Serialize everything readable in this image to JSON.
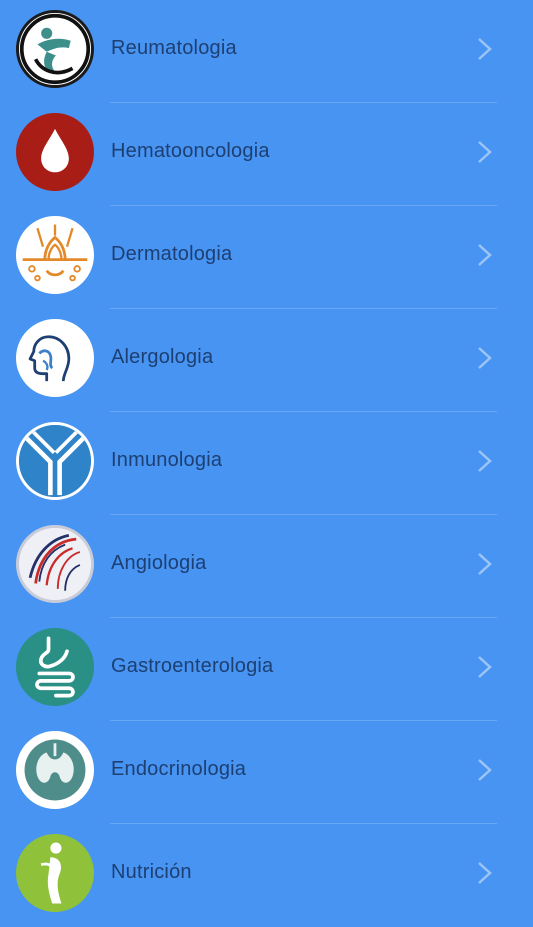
{
  "items": [
    {
      "label": "Reumatologia",
      "icon": "rheumatology-icon"
    },
    {
      "label": "Hematooncologia",
      "icon": "blood-drop-icon"
    },
    {
      "label": "Dermatologia",
      "icon": "skin-hair-icon"
    },
    {
      "label": "Alergologia",
      "icon": "head-airway-icon"
    },
    {
      "label": "Inmunologia",
      "icon": "antibody-icon"
    },
    {
      "label": "Angiologia",
      "icon": "blood-vessels-icon"
    },
    {
      "label": "Gastroenterologia",
      "icon": "stomach-intestine-icon"
    },
    {
      "label": "Endocrinologia",
      "icon": "thyroid-icon"
    },
    {
      "label": "Nutrición",
      "icon": "nutrition-body-icon"
    }
  ],
  "chevron_icon": "chevron-right-icon",
  "colors": {
    "background": "#4794f2",
    "label": "#1d3f72",
    "chevron": "#9cc4f7"
  }
}
